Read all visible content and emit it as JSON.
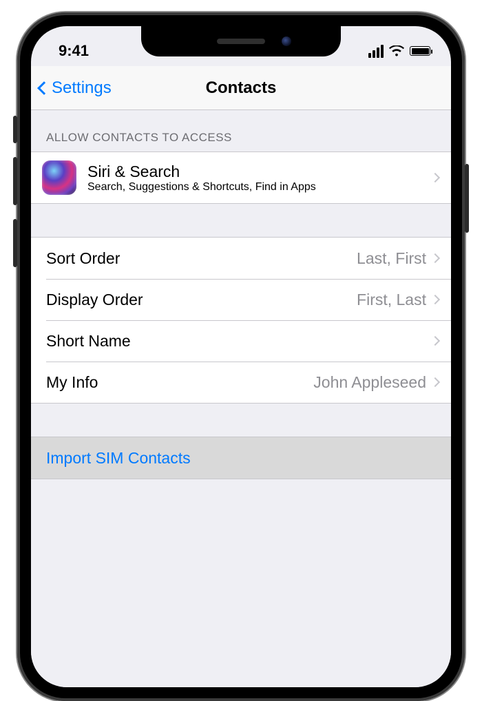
{
  "status": {
    "time": "9:41"
  },
  "nav": {
    "back_label": "Settings",
    "title": "Contacts"
  },
  "section1": {
    "header": "Allow Contacts to Access",
    "siri": {
      "title": "Siri & Search",
      "subtitle": "Search, Suggestions & Shortcuts, Find in Apps"
    }
  },
  "section2": {
    "sort_order": {
      "label": "Sort Order",
      "value": "Last, First"
    },
    "display_order": {
      "label": "Display Order",
      "value": "First, Last"
    },
    "short_name": {
      "label": "Short Name",
      "value": ""
    },
    "my_info": {
      "label": "My Info",
      "value": "John Appleseed"
    }
  },
  "section3": {
    "import": {
      "label": "Import SIM Contacts"
    }
  },
  "colors": {
    "ios_blue": "#007aff",
    "secondary_text": "#8e8e93",
    "separator": "#c8c7cc",
    "group_bg": "#efeff4"
  }
}
